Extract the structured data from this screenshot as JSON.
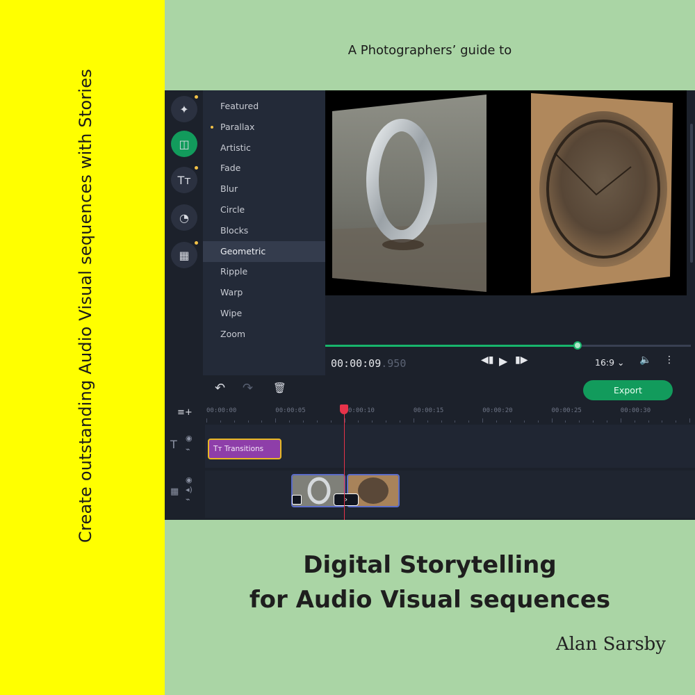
{
  "spine": {
    "text": "Create outstanding Audio Visual sequences with Stories"
  },
  "cover": {
    "subtitle": "A Photographers’ guide to",
    "title_line1": "Digital Storytelling",
    "title_line2": "for Audio Visual sequences",
    "author": "Alan Sarsby"
  },
  "app": {
    "rail": [
      {
        "icon": "magic-wand-icon",
        "glyph": "✦",
        "active": false,
        "dot": true
      },
      {
        "icon": "transitions-icon",
        "glyph": "◫",
        "active": true,
        "dot": false
      },
      {
        "icon": "titles-icon",
        "glyph": "Tт",
        "active": false,
        "dot": true
      },
      {
        "icon": "stickers-icon",
        "glyph": "◔",
        "active": false,
        "dot": false
      },
      {
        "icon": "more-tools-icon",
        "glyph": "▦",
        "active": false,
        "dot": true
      }
    ],
    "categories": [
      "Featured",
      "Parallax",
      "Artistic",
      "Fade",
      "Blur",
      "Circle",
      "Blocks",
      "Geometric",
      "Ripple",
      "Warp",
      "Wipe",
      "Zoom"
    ],
    "selected_category": "Geometric",
    "new_category": "Parallax",
    "player": {
      "timecode_main": "00:00:09",
      "timecode_ms": ".950",
      "progress": 0.69,
      "aspect_ratio": "16:9",
      "prev_glyph": "◀︎▮",
      "play_glyph": "▶",
      "next_glyph": "▮▶︎",
      "volume_glyph": "🔈",
      "menu_glyph": "⋮"
    },
    "timeline": {
      "add_track_glyph": "≡+",
      "undo_glyph": "↶",
      "redo_glyph": "↷",
      "delete_glyph": "🗑",
      "export_label": "Export",
      "ruler_labels": [
        "00:00:00",
        "00:00:05",
        "00:00:10",
        "00:00:15",
        "00:00:20",
        "00:00:25",
        "00:00:30"
      ],
      "title_clip": {
        "glyph": "Tт",
        "label": "Transitions"
      },
      "transition_glyph": "›",
      "playhead_seconds": 9.95
    },
    "colors": {
      "accent_green": "#129b5c",
      "playhead_red": "#e8334a",
      "title_clip_purple": "#8e3ea9",
      "title_clip_border": "#e9b923"
    }
  }
}
